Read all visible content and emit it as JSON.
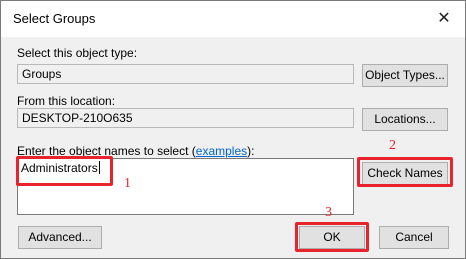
{
  "window": {
    "title": "Select Groups",
    "close_glyph": "✕"
  },
  "object_type": {
    "label": "Select this object type:",
    "value": "Groups",
    "button": "Object Types..."
  },
  "location": {
    "label": "From this location:",
    "value": "DESKTOP-210O635",
    "button": "Locations..."
  },
  "names": {
    "label_prefix": "Enter the object names to select (",
    "label_link": "examples",
    "label_suffix": "):",
    "value": "Administrators",
    "check_button": "Check Names"
  },
  "buttons": {
    "advanced": "Advanced...",
    "ok": "OK",
    "cancel": "Cancel"
  },
  "annotations": {
    "step1": "1",
    "step2": "2",
    "step3": "3",
    "color": "#e8232b"
  }
}
